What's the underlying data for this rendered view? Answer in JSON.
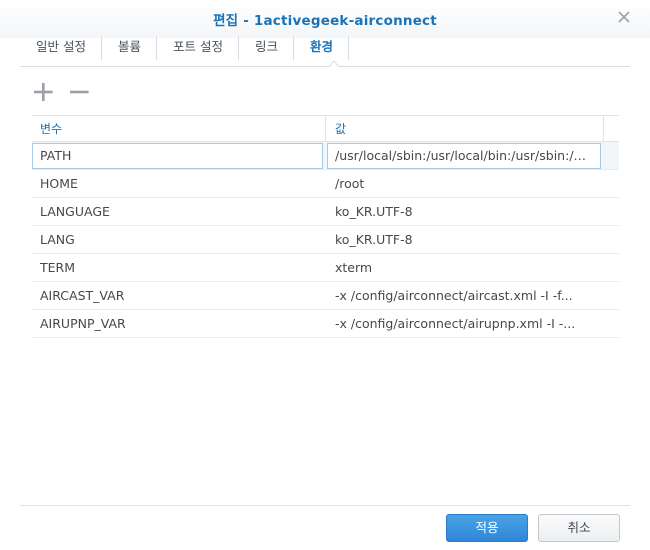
{
  "window": {
    "title": "편집 - 1activegeek-airconnect"
  },
  "tabs": [
    {
      "label": "일반 설정",
      "active": false
    },
    {
      "label": "볼륨",
      "active": false
    },
    {
      "label": "포트 설정",
      "active": false
    },
    {
      "label": "링크",
      "active": false
    },
    {
      "label": "환경",
      "active": true
    }
  ],
  "toolbar": {
    "add_icon": "plus-icon",
    "remove_icon": "minus-icon"
  },
  "grid": {
    "columns": [
      "변수",
      "값"
    ],
    "editing_row": {
      "key": "PATH",
      "value": "/usr/local/sbin:/usr/local/bin:/usr/sbin:/usr/bin:/sbin:/bin"
    },
    "rows": [
      {
        "key": "HOME",
        "value": "/root"
      },
      {
        "key": "LANGUAGE",
        "value": "ko_KR.UTF-8"
      },
      {
        "key": "LANG",
        "value": "ko_KR.UTF-8"
      },
      {
        "key": "TERM",
        "value": "xterm"
      },
      {
        "key": "AIRCAST_VAR",
        "value": "-x /config/airconnect/aircast.xml -I -f..."
      },
      {
        "key": "AIRUPNP_VAR",
        "value": "-x /config/airconnect/airupnp.xml -I -..."
      }
    ]
  },
  "footer": {
    "ok_label": "적용",
    "cancel_label": "취소"
  },
  "colors": {
    "accent": "#1a73b8",
    "primary_button": "#2f86d6"
  }
}
